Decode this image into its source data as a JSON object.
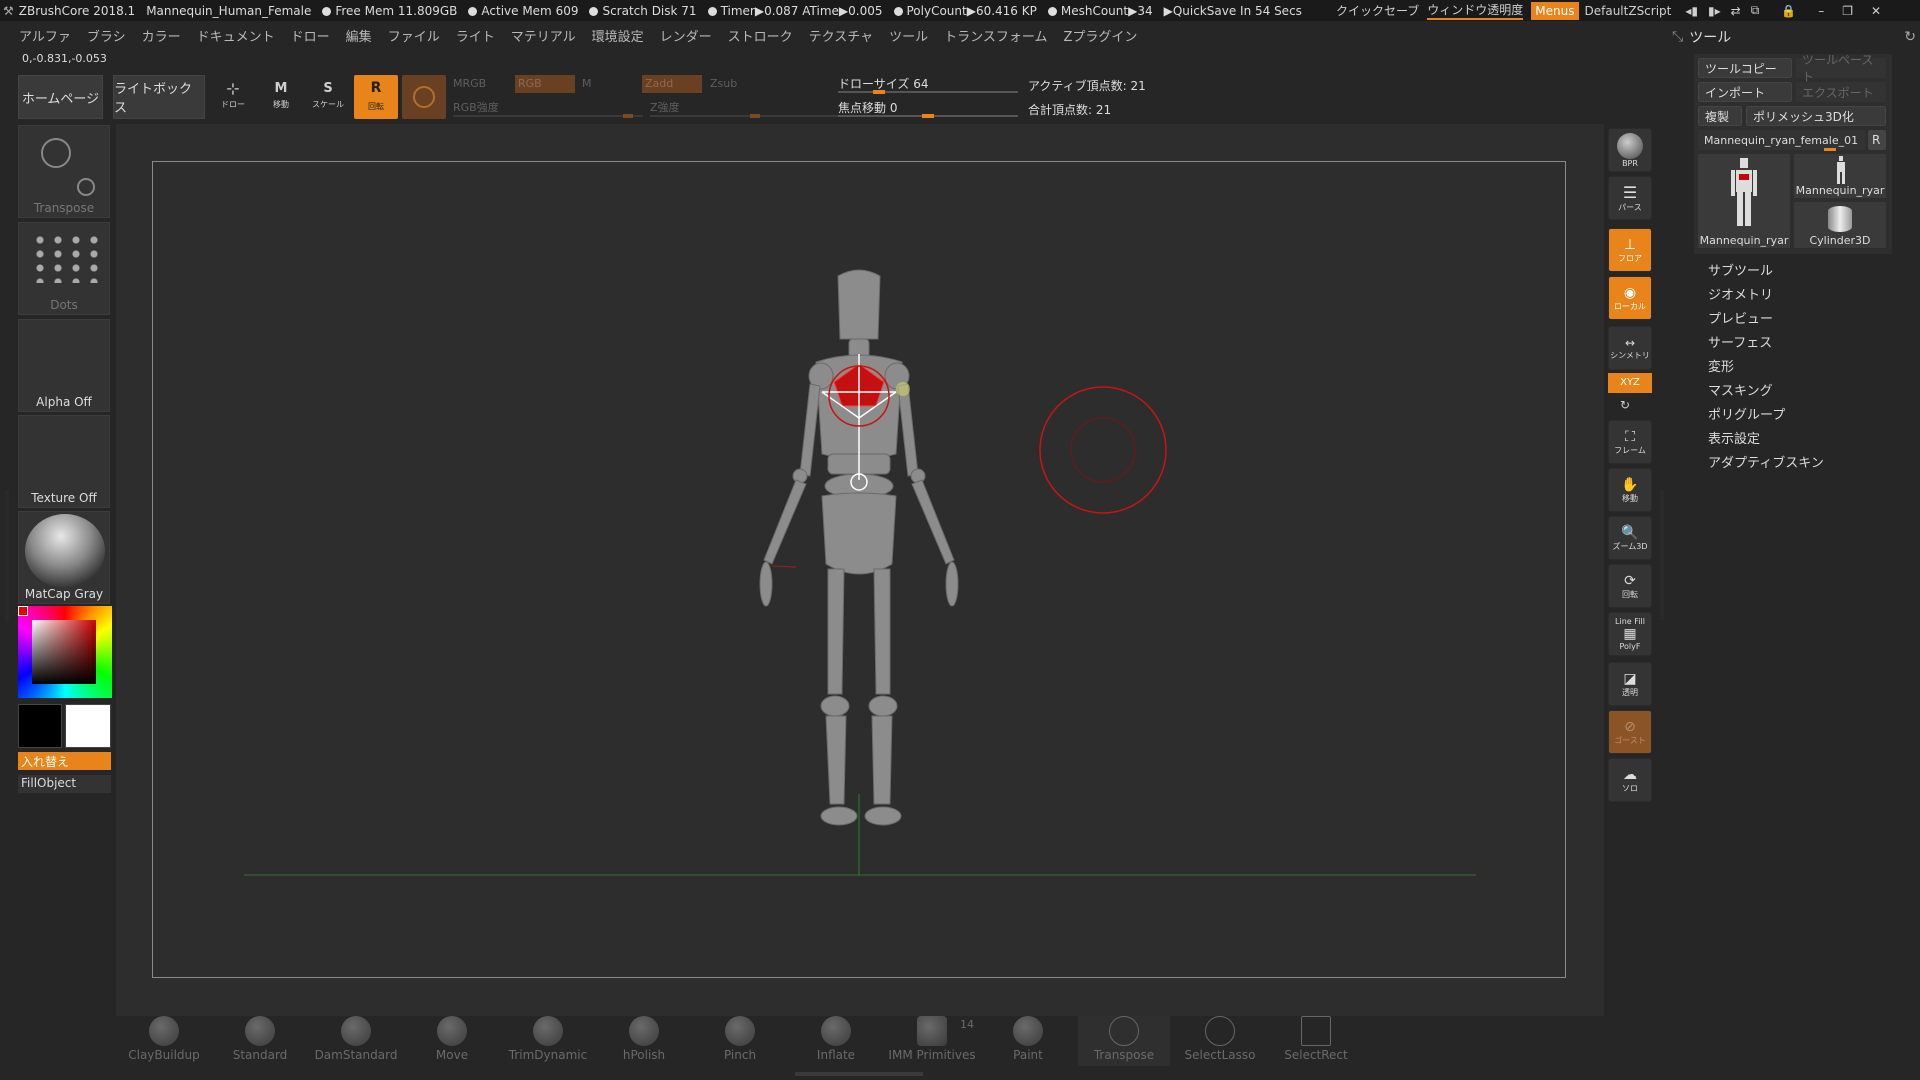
{
  "titlebar": {
    "app": "ZBrushCore 2018.1",
    "doc": "Mannequin_Human_Female",
    "free_mem": "Free Mem 11.809GB",
    "active_mem": "Active Mem 609",
    "scratch": "Scratch Disk 71",
    "timer": "Timer▶0.087 ATime▶0.005",
    "polycount": "PolyCount▶60.416 KP",
    "meshcount": "MeshCount▶34",
    "quicksave": "▶QuickSave In 54 Secs",
    "quick_save_btn": "クイックセーブ",
    "transparency": "ウィンドウ透明度",
    "menus": "Menus",
    "script": "DefaultZScript"
  },
  "menu": [
    "アルファ",
    "ブラシ",
    "カラー",
    "ドキュメント",
    "ドロー",
    "編集",
    "ファイル",
    "ライト",
    "マテリアル",
    "環境設定",
    "レンダー",
    "ストローク",
    "テクスチャ",
    "ツール",
    "トランスフォーム",
    "Zプラグイン"
  ],
  "coords": "0,-0.831,-0.053",
  "top": {
    "home": "ホームページ",
    "lightbox": "ライトボックス",
    "draw": "ドロー",
    "move": "移動",
    "scale": "スケール",
    "rotate": "回転",
    "mrgb": "MRGB",
    "rgb": "RGB",
    "m": "M",
    "zadd": "Zadd",
    "zsub": "Zsub",
    "rgb_int": "RGB強度",
    "z_int": "Z強度",
    "draw_size": "ドローサイズ 64",
    "focal": "焦点移動 0",
    "active_pts": "アクティブ頂点数: 21",
    "total_pts": "合計頂点数: 21"
  },
  "left": {
    "transpose": "Transpose",
    "dots": "Dots",
    "alpha": "Alpha Off",
    "texture": "Texture Off",
    "matcap": "MatCap Gray",
    "swap": "入れ替え",
    "fill": "FillObject"
  },
  "right": {
    "bpr": "BPR",
    "perspective": "パース",
    "floor": "フロア",
    "local": "ローカル",
    "symmetry": "シンメトリ",
    "xyz": "XYZ",
    "frame": "フレーム",
    "move": "移動",
    "zoom3d": "ズーム3D",
    "rotate": "回転",
    "linefill": "Line Fill",
    "polyf": "PolyF",
    "transp": "透明",
    "ghost": "ゴースト",
    "solo": "ソロ"
  },
  "tool": {
    "title": "ツール",
    "copy": "ツールコピー",
    "paste": "ツールペースト",
    "import": "インポート",
    "export": "エクスポート",
    "clone": "複製",
    "polymesh": "ポリメッシュ3D化",
    "current": "Mannequin_ryan_female_01",
    "r": "R",
    "thumb1": "Mannequin_ryar",
    "thumb2": "Mannequin_ryar",
    "thumb3": "Cylinder3D",
    "subpanels": [
      "サブツール",
      "ジオメトリ",
      "プレビュー",
      "サーフェス",
      "変形",
      "マスキング",
      "ポリグループ",
      "表示設定",
      "アダプティブスキン"
    ]
  },
  "brushes": [
    "ClayBuildup",
    "Standard",
    "DamStandard",
    "Move",
    "TrimDynamic",
    "hPolish",
    "Pinch",
    "Inflate",
    "IMM Primitives",
    "Paint",
    "Transpose",
    "SelectLasso",
    "SelectRect"
  ],
  "imm_count": "14"
}
